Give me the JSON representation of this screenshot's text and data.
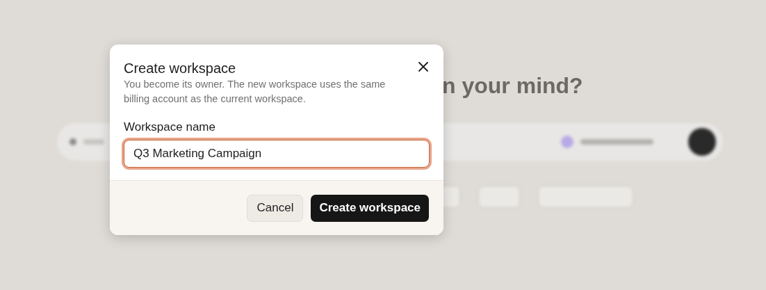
{
  "background": {
    "heading": "n your mind?"
  },
  "dialog": {
    "title": "Create workspace",
    "description": "You become its owner. The new workspace uses the same billing account as the current workspace.",
    "field": {
      "label": "Workspace name",
      "value": "Q3 Marketing Campaign",
      "focused": true
    },
    "buttons": [
      {
        "label": "Cancel",
        "kind": "secondary"
      },
      {
        "label": "Create workspace",
        "kind": "primary"
      }
    ]
  }
}
